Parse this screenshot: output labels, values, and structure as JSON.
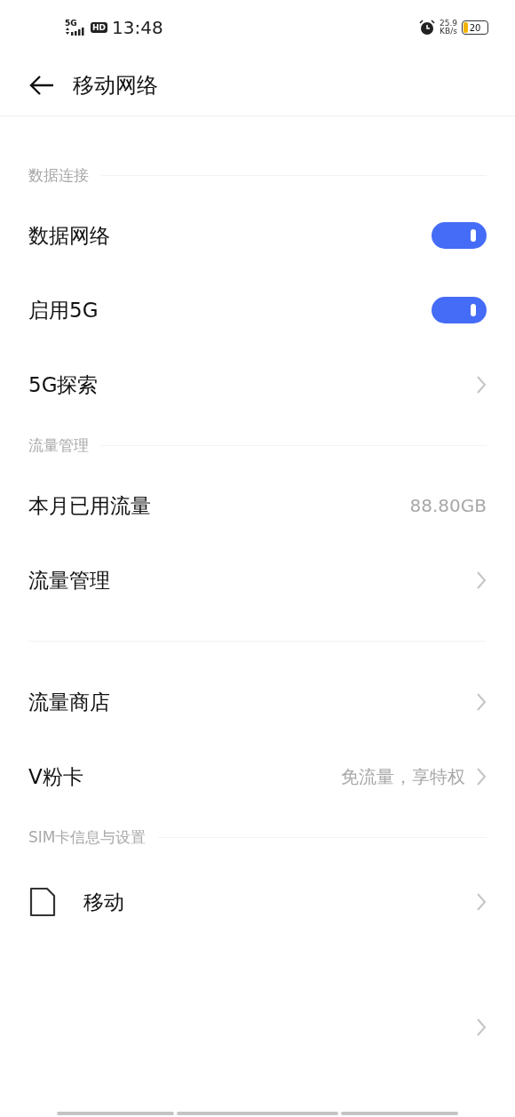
{
  "status_bar": {
    "network_label": "5G",
    "hd_label": "HD",
    "time": "13:48",
    "speed_value": "25.9",
    "speed_unit": "KB/s",
    "battery": "20"
  },
  "header": {
    "title": "移动网络"
  },
  "items": [
    {
      "kind": "section",
      "label": "数据连接"
    },
    {
      "kind": "toggle",
      "label": "数据网络",
      "on": true
    },
    {
      "kind": "toggle",
      "label": "启用5G",
      "on": true
    },
    {
      "kind": "link",
      "label": "5G探索"
    },
    {
      "kind": "section",
      "label": "流量管理"
    },
    {
      "kind": "value",
      "label": "本月已用流量",
      "value": "88.80GB"
    },
    {
      "kind": "link",
      "label": "流量管理"
    },
    {
      "kind": "spacer"
    },
    {
      "kind": "link",
      "label": "流量商店"
    },
    {
      "kind": "link",
      "label": "V粉卡",
      "value": "免流量，享特权"
    },
    {
      "kind": "section",
      "label": "SIM卡信息与设置"
    },
    {
      "kind": "sim",
      "label": "移动"
    },
    {
      "kind": "link_hidden"
    }
  ]
}
